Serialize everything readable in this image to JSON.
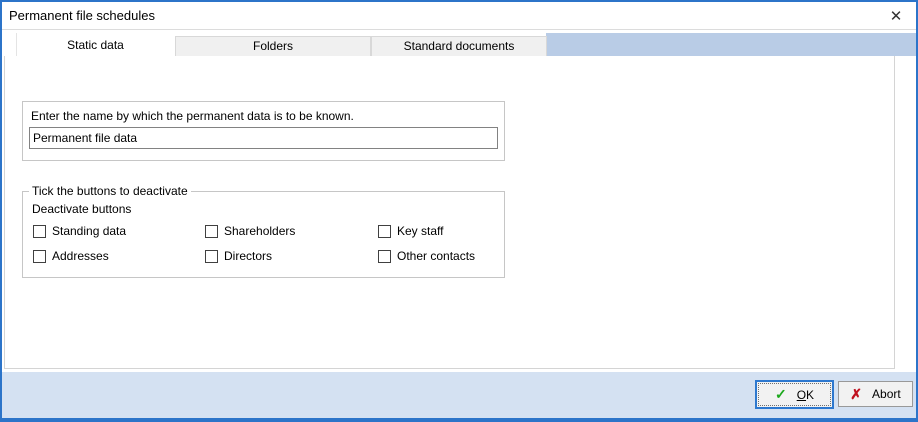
{
  "window": {
    "title": "Permanent file schedules",
    "close_icon": "✕"
  },
  "tabs": {
    "active": "Static data",
    "items": [
      {
        "label": "Static data"
      },
      {
        "label": "Folders"
      },
      {
        "label": "Standard documents"
      }
    ]
  },
  "name_group": {
    "prompt": "Enter the name by which the permanent data is to be known.",
    "input_value": "Permanent file data"
  },
  "deactivate_group": {
    "legend": "Tick the buttons to deactivate",
    "heading": "Deactivate buttons",
    "checkboxes": [
      {
        "label": "Standing data",
        "checked": false
      },
      {
        "label": "Shareholders",
        "checked": false
      },
      {
        "label": "Key staff",
        "checked": false
      },
      {
        "label": "Addresses",
        "checked": false
      },
      {
        "label": "Directors",
        "checked": false
      },
      {
        "label": "Other contacts",
        "checked": false
      }
    ]
  },
  "footer": {
    "ok": {
      "icon": "✓",
      "mnemonic": "O",
      "rest": "K"
    },
    "abort": {
      "icon": "✗",
      "label": "Abort"
    }
  },
  "colors": {
    "window_border": "#2c74c9",
    "tab_filler": "#b9cce6",
    "footer_bg": "#d4e1f2",
    "ok_border": "#2d78cf",
    "ok_check": "#1ca81c",
    "abort_x": "#c0111f"
  }
}
